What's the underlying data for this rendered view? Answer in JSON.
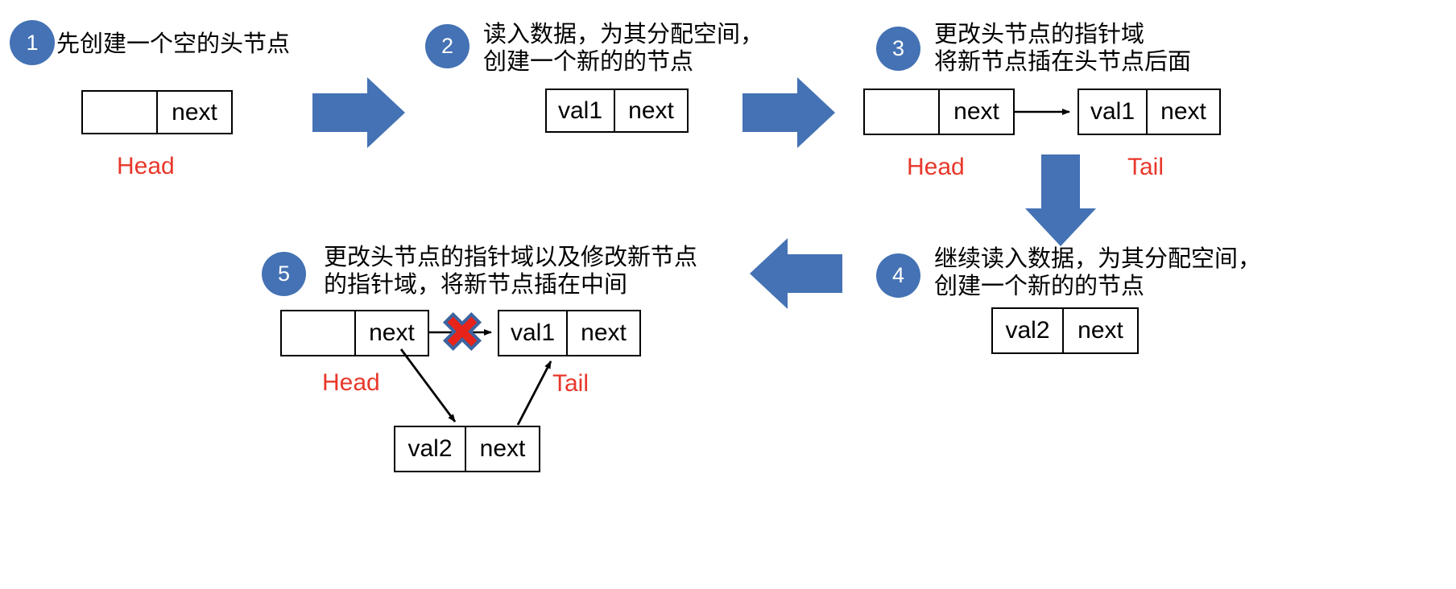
{
  "diagram": {
    "title_semantics": "linked-list-tail-insertion-steps",
    "colors": {
      "badge_blue": "#4472b4",
      "arrow_blue": "#4472b4",
      "label_red": "#e8372a",
      "line_black": "#000000",
      "background": "#ffffff"
    },
    "steps": [
      {
        "number": "1",
        "lines": [
          "先创建一个空的头节点"
        ]
      },
      {
        "number": "2",
        "lines": [
          "读入数据，为其分配空间，",
          "创建一个新的的节点"
        ]
      },
      {
        "number": "3",
        "lines": [
          "更改头节点的指针域",
          "将新节点插在头节点后面"
        ]
      },
      {
        "number": "4",
        "lines": [
          "继续读入数据，为其分配空间，",
          "创建一个新的的节点"
        ]
      },
      {
        "number": "5",
        "lines": [
          "更改头节点的指针域以及修改新节点",
          "的指针域，将新节点插在中间"
        ]
      }
    ],
    "nodes": {
      "step1_head": {
        "value": "",
        "next": "next"
      },
      "step2_new": {
        "value": "val1",
        "next": "next"
      },
      "step3_head": {
        "value": "",
        "next": "next"
      },
      "step3_tail": {
        "value": "val1",
        "next": "next"
      },
      "step4_new": {
        "value": "val2",
        "next": "next"
      },
      "step5_head": {
        "value": "",
        "next": "next"
      },
      "step5_first": {
        "value": "val1",
        "next": "next"
      },
      "step5_second": {
        "value": "val2",
        "next": "next"
      }
    },
    "pointer_labels": {
      "step1_head": "Head",
      "step3_head": "Head",
      "step3_tail": "Tail",
      "step5_head": "Head",
      "step5_tail": "Tail"
    },
    "markers": {
      "broken_link": "x-cross-icon"
    },
    "flow_arrows": [
      {
        "name": "arrow-step1-to-step2",
        "direction": "right"
      },
      {
        "name": "arrow-step2-to-step3",
        "direction": "right"
      },
      {
        "name": "arrow-step3-to-step4",
        "direction": "down"
      },
      {
        "name": "arrow-step4-to-step5",
        "direction": "left"
      }
    ]
  }
}
